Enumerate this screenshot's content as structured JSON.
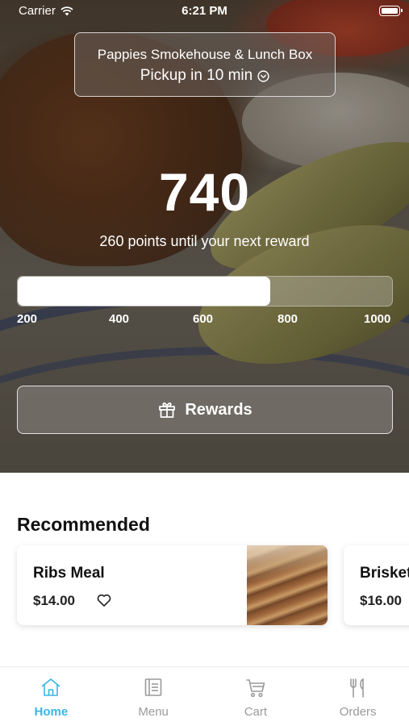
{
  "status_bar": {
    "carrier": "Carrier",
    "time": "6:21 PM"
  },
  "location": {
    "restaurant_name": "Pappies Smokehouse & Lunch Box",
    "pickup_text": "Pickup in 10 min",
    "dropdown_icon": "chevron-circle-down-icon"
  },
  "rewards": {
    "points": "740",
    "caption": "260 points until your next reward",
    "progress_value": 740,
    "progress_min": 200,
    "progress_max": 1000,
    "ticks": [
      "200",
      "400",
      "600",
      "800",
      "1000"
    ],
    "button_label": "Rewards",
    "button_icon": "gift-icon"
  },
  "recommended": {
    "title": "Recommended",
    "items": [
      {
        "name": "Ribs Meal",
        "price": "$14.00",
        "icon": "heart-icon"
      },
      {
        "name": "Brisket",
        "price": "$16.00"
      }
    ]
  },
  "tabs": [
    {
      "label": "Home",
      "icon": "home-icon",
      "active": true
    },
    {
      "label": "Menu",
      "icon": "menu-icon",
      "active": false
    },
    {
      "label": "Cart",
      "icon": "cart-icon",
      "active": false
    },
    {
      "label": "Orders",
      "icon": "fork-knife-icon",
      "active": false
    }
  ],
  "colors": {
    "accent": "#3ab5e3",
    "inactive": "#9a9a9a"
  }
}
